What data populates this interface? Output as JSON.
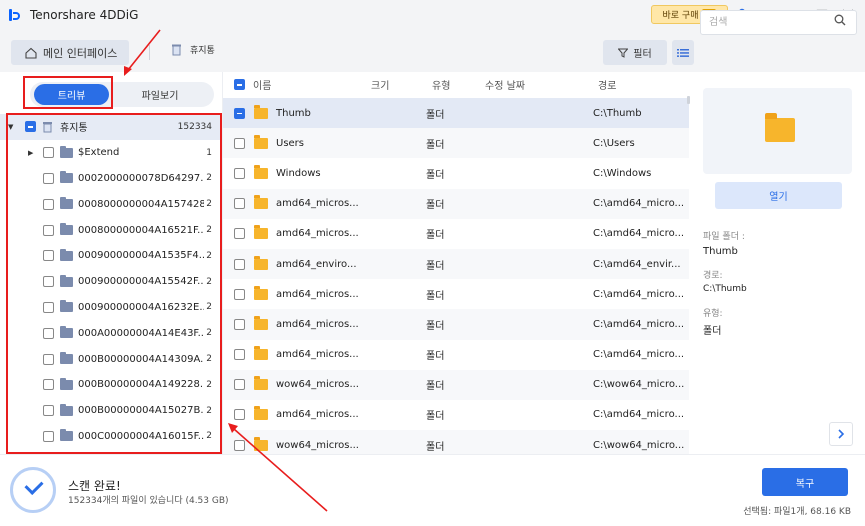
{
  "app": {
    "title": "Tenorshare 4DDiG",
    "buy_label": "바로 구매"
  },
  "nav": {
    "main_tab": "메인 인터페이스",
    "crumb": "휴지통",
    "filter_label": "필터",
    "search_placeholder": "검색"
  },
  "left_panel": {
    "tree_tab": "트리뷰",
    "file_tab": "파일보기",
    "root": {
      "label": "휴지통",
      "count": "152334"
    },
    "items": [
      {
        "label": "$Extend",
        "count": "1"
      },
      {
        "label": "0002000000078D64297...",
        "count": "2"
      },
      {
        "label": "0008000000004A157428...",
        "count": "2"
      },
      {
        "label": "000800000004A16521F...",
        "count": "2"
      },
      {
        "label": "000900000004A1535F4...",
        "count": "2"
      },
      {
        "label": "000900000004A15542F...",
        "count": "2"
      },
      {
        "label": "000900000004A16232E...",
        "count": "2"
      },
      {
        "label": "000A00000004A14E43F...",
        "count": "2"
      },
      {
        "label": "000B00000004A14309A...",
        "count": "2"
      },
      {
        "label": "000B00000004A149228...",
        "count": "2"
      },
      {
        "label": "000B00000004A15027B...",
        "count": "2"
      },
      {
        "label": "000C00000004A16015F...",
        "count": "2"
      }
    ]
  },
  "file_list": {
    "columns": {
      "name": "이름",
      "size": "크기",
      "type": "유형",
      "modified": "수정 날짜",
      "path": "경로"
    },
    "rows": [
      {
        "name": "Thumb",
        "type": "폴더",
        "path": "C:\\Thumb"
      },
      {
        "name": "Users",
        "type": "폴더",
        "path": "C:\\Users"
      },
      {
        "name": "Windows",
        "type": "폴더",
        "path": "C:\\Windows"
      },
      {
        "name": "amd64_micros...",
        "type": "폴더",
        "path": "C:\\amd64_micro..."
      },
      {
        "name": "amd64_micros...",
        "type": "폴더",
        "path": "C:\\amd64_micro..."
      },
      {
        "name": "amd64_enviro...",
        "type": "폴더",
        "path": "C:\\amd64_envir..."
      },
      {
        "name": "amd64_micros...",
        "type": "폴더",
        "path": "C:\\amd64_micro..."
      },
      {
        "name": "amd64_micros...",
        "type": "폴더",
        "path": "C:\\amd64_micro..."
      },
      {
        "name": "amd64_micros...",
        "type": "폴더",
        "path": "C:\\amd64_micro..."
      },
      {
        "name": "wow64_micros...",
        "type": "폴더",
        "path": "C:\\wow64_micro..."
      },
      {
        "name": "amd64_micros...",
        "type": "폴더",
        "path": "C:\\amd64_micro..."
      },
      {
        "name": "wow64_micros...",
        "type": "폴더",
        "path": "C:\\wow64_micro..."
      }
    ]
  },
  "details": {
    "open_label": "열기",
    "folder_label": "파일 폴더 :",
    "folder_value": "Thumb",
    "path_label": "경로:",
    "path_value": "C:\\Thumb",
    "type_label": "유형:",
    "type_value": "폴더"
  },
  "status": {
    "title": "스캔 완료!",
    "subtitle": "152334개의 파일이 있습니다 (4.53 GB)",
    "recover_label": "복구",
    "selected_info": "선택됨: 파일1개, 68.16 KB"
  },
  "colors": {
    "accent": "#2a6ee6",
    "annotation": "#e81d1d",
    "folder": "#f7b52c"
  }
}
